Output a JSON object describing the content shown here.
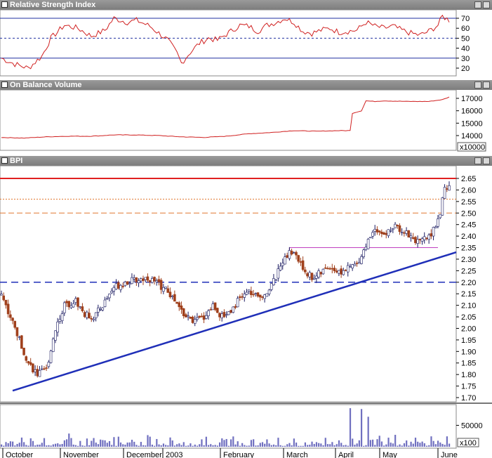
{
  "panels": {
    "rsi": {
      "title": "Relative Strength Index",
      "ticks": [
        70,
        60,
        50,
        40,
        30,
        20
      ],
      "levels": [
        30,
        50,
        70
      ]
    },
    "obv": {
      "title": "On Balance Volume",
      "ticks": [
        17000,
        16000,
        15000,
        14000
      ],
      "unit": "x10000"
    },
    "price": {
      "title": "BPI",
      "ticks": [
        "2.65",
        "2.60",
        "2.55",
        "2.50",
        "2.45",
        "2.40",
        "2.35",
        "2.30",
        "2.25",
        "2.20",
        "2.15",
        "2.10",
        "2.05",
        "2.00",
        "1.95",
        "1.90",
        "1.85",
        "1.80",
        "1.75",
        "1.70"
      ]
    },
    "volume": {
      "ticks": [
        "50000"
      ],
      "unit": "x100"
    }
  },
  "months": [
    "October",
    "November",
    "December",
    "2003",
    "February",
    "March",
    "April",
    "May",
    "June"
  ],
  "colors": {
    "up": "#ffffff",
    "down": "#a0401c",
    "trend": "#1f2fb8",
    "resistance": "#e02020",
    "fib": "#e07830",
    "support": "#1f2fb8",
    "box": "#c040c0",
    "rsi": "#d02020",
    "volume": "#7070c0"
  },
  "chart_data": {
    "type": "candlestick",
    "title": "BPI",
    "xlabel": "",
    "ylabel": "",
    "x_range": [
      "2002-10",
      "2003-06"
    ],
    "price_ylim": [
      1.7,
      2.65
    ],
    "rsi_ylim": [
      15,
      75
    ],
    "obv_ylim": [
      13500,
      17500
    ],
    "price_anchors": [
      [
        0,
        2.15
      ],
      [
        4,
        2.05
      ],
      [
        8,
        1.95
      ],
      [
        12,
        1.85
      ],
      [
        16,
        1.8
      ],
      [
        20,
        1.82
      ],
      [
        24,
        2.0
      ],
      [
        28,
        2.1
      ],
      [
        33,
        2.12
      ],
      [
        37,
        2.06
      ],
      [
        41,
        2.05
      ],
      [
        45,
        2.1
      ],
      [
        50,
        2.18
      ],
      [
        55,
        2.2
      ],
      [
        60,
        2.21
      ],
      [
        65,
        2.22
      ],
      [
        70,
        2.19
      ],
      [
        74,
        2.16
      ],
      [
        78,
        2.1
      ],
      [
        82,
        2.05
      ],
      [
        86,
        2.03
      ],
      [
        90,
        2.05
      ],
      [
        94,
        2.1
      ],
      [
        98,
        2.05
      ],
      [
        102,
        2.08
      ],
      [
        106,
        2.13
      ],
      [
        110,
        2.16
      ],
      [
        114,
        2.13
      ],
      [
        118,
        2.16
      ],
      [
        122,
        2.22
      ],
      [
        126,
        2.32
      ],
      [
        130,
        2.33
      ],
      [
        134,
        2.26
      ],
      [
        138,
        2.22
      ],
      [
        142,
        2.24
      ],
      [
        146,
        2.27
      ],
      [
        150,
        2.24
      ],
      [
        154,
        2.26
      ],
      [
        158,
        2.28
      ],
      [
        162,
        2.36
      ],
      [
        166,
        2.44
      ],
      [
        170,
        2.4
      ],
      [
        174,
        2.44
      ],
      [
        178,
        2.43
      ],
      [
        182,
        2.4
      ],
      [
        186,
        2.37
      ],
      [
        190,
        2.4
      ],
      [
        194,
        2.46
      ],
      [
        197,
        2.6
      ],
      [
        199,
        2.62
      ]
    ],
    "rsi_anchors": [
      [
        0,
        30
      ],
      [
        6,
        24
      ],
      [
        12,
        20
      ],
      [
        18,
        32
      ],
      [
        22,
        50
      ],
      [
        28,
        63
      ],
      [
        34,
        60
      ],
      [
        40,
        52
      ],
      [
        46,
        58
      ],
      [
        50,
        70
      ],
      [
        56,
        66
      ],
      [
        60,
        68
      ],
      [
        66,
        62
      ],
      [
        70,
        55
      ],
      [
        74,
        48
      ],
      [
        78,
        35
      ],
      [
        80,
        25
      ],
      [
        84,
        36
      ],
      [
        88,
        45
      ],
      [
        92,
        50
      ],
      [
        96,
        48
      ],
      [
        100,
        54
      ],
      [
        106,
        63
      ],
      [
        110,
        62
      ],
      [
        114,
        57
      ],
      [
        118,
        63
      ],
      [
        122,
        66
      ],
      [
        126,
        70
      ],
      [
        130,
        66
      ],
      [
        134,
        57
      ],
      [
        138,
        55
      ],
      [
        142,
        58
      ],
      [
        146,
        60
      ],
      [
        150,
        56
      ],
      [
        154,
        57
      ],
      [
        158,
        58
      ],
      [
        162,
        66
      ],
      [
        166,
        62
      ],
      [
        170,
        60
      ],
      [
        174,
        62
      ],
      [
        178,
        58
      ],
      [
        182,
        55
      ],
      [
        186,
        53
      ],
      [
        190,
        57
      ],
      [
        194,
        63
      ],
      [
        196,
        72
      ],
      [
        199,
        68
      ]
    ],
    "obv_anchors": [
      [
        0,
        13850
      ],
      [
        10,
        13800
      ],
      [
        20,
        13900
      ],
      [
        30,
        13950
      ],
      [
        40,
        13950
      ],
      [
        50,
        14050
      ],
      [
        60,
        14050
      ],
      [
        70,
        14000
      ],
      [
        80,
        13900
      ],
      [
        90,
        13850
      ],
      [
        100,
        13950
      ],
      [
        110,
        14150
      ],
      [
        120,
        14250
      ],
      [
        130,
        14400
      ],
      [
        140,
        14350
      ],
      [
        150,
        14400
      ],
      [
        155,
        14400
      ],
      [
        156,
        15800
      ],
      [
        160,
        16000
      ],
      [
        162,
        16800
      ],
      [
        166,
        16750
      ],
      [
        170,
        16800
      ],
      [
        180,
        16750
      ],
      [
        190,
        16750
      ],
      [
        196,
        16900
      ],
      [
        199,
        17100
      ]
    ],
    "volume_spikes": [
      [
        155,
        90000
      ],
      [
        160,
        88000
      ],
      [
        163,
        70000
      ]
    ],
    "trendline": [
      [
        5,
        1.73
      ],
      [
        199,
        2.33
      ]
    ],
    "levels": {
      "resistance": 2.65,
      "fib1": 2.56,
      "fib2": 2.5,
      "support": 2.2,
      "box_top": 2.35,
      "box_x": [
        128,
        194
      ]
    }
  }
}
